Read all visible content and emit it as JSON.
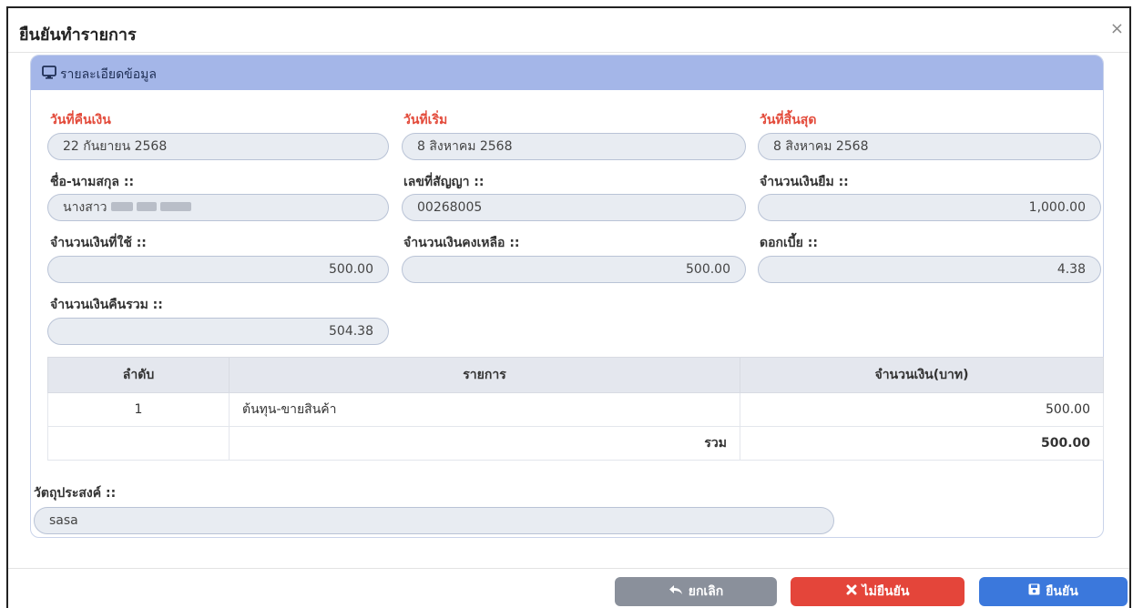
{
  "modal": {
    "title": "ยืนยันทำรายการ",
    "close": "×"
  },
  "panel": {
    "title": "รายละเอียดข้อมูล"
  },
  "fields": {
    "return_date_label": "วันที่คืนเงิน",
    "return_date": "22 กันยายน 2568",
    "start_date_label": "วันที่เริ่ม",
    "start_date": "8 สิงหาคม 2568",
    "end_date_label": "วันที่สิ้นสุด",
    "end_date": "8 สิงหาคม 2568",
    "name_label": "ชื่อ-นามสกุล ::",
    "name_prefix": "นางสาว",
    "contract_label": "เลขที่สัญญา ::",
    "contract": "00268005",
    "loan_amount_label": "จำนวนเงินยืม ::",
    "loan_amount": "1,000.00",
    "used_amount_label": "จำนวนเงินที่ใช้ ::",
    "used_amount": "500.00",
    "remaining_label": "จำนวนเงินคงเหลือ ::",
    "remaining": "500.00",
    "interest_label": "ดอกเบี้ย ::",
    "interest": "4.38",
    "total_return_label": "จำนวนเงินคืนรวม ::",
    "total_return": "504.38"
  },
  "table": {
    "headers": [
      "ลำดับ",
      "รายการ",
      "จำนวนเงิน(บาท)"
    ],
    "rows": [
      {
        "no": "1",
        "item": "ต้นทุน-ขายสินค้า",
        "amount": "500.00"
      }
    ],
    "total_label": "รวม",
    "total": "500.00"
  },
  "purpose": {
    "label": "วัตถุประสงค์ ::",
    "value": "sasa"
  },
  "buttons": {
    "cancel": "ยกเลิก",
    "reject": "ไม่ยืนยัน",
    "confirm": "ยืนยัน"
  }
}
